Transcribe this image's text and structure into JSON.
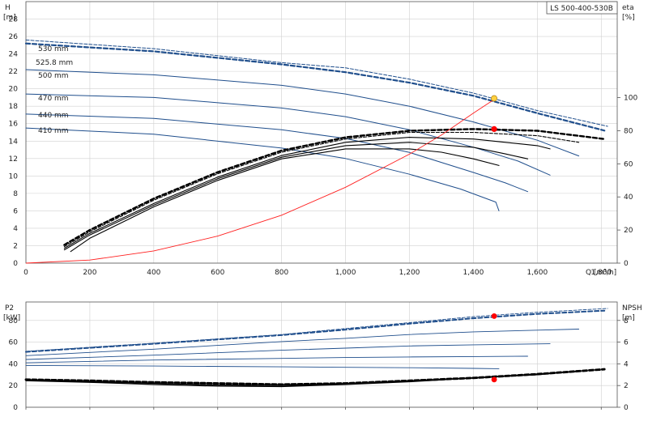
{
  "model": "LS 500-400-530B",
  "colors": {
    "curve": "#1f4e8c",
    "efficiency": "#000000",
    "system": "#ff2020",
    "duty_point": "#ff0000",
    "duty_point_top": "#ffd040",
    "grid": "#d0d0d0"
  },
  "chart_data": [
    {
      "id": "head",
      "type": "line",
      "x_label": "Q [m³/h]",
      "y_label_left": [
        "H",
        "[m]"
      ],
      "y_label_right": [
        "eta",
        "[%]"
      ],
      "xlim": [
        0,
        1850
      ],
      "ylim": [
        0,
        30
      ],
      "y2lim": [
        0,
        158
      ],
      "x_ticks": [
        0,
        200,
        400,
        600,
        800,
        1000,
        1200,
        1400,
        1600,
        1800
      ],
      "x_tick_labels": [
        "0",
        "200",
        "400",
        "600",
        "800",
        "1,000",
        "1,200",
        "1,400",
        "1,600",
        "1,800"
      ],
      "y_ticks": [
        0,
        2,
        4,
        6,
        8,
        10,
        12,
        14,
        16,
        18,
        20,
        22,
        24,
        26,
        28
      ],
      "y2_ticks": [
        0,
        20,
        40,
        60,
        80,
        100
      ],
      "grid": true,
      "series": [
        {
          "name": "530 mm",
          "style": "dashed-thin",
          "points": [
            [
              0,
              25.6
            ],
            [
              400,
              24.6
            ],
            [
              800,
              23.0
            ],
            [
              1000,
              22.4
            ],
            [
              1200,
              21.1
            ],
            [
              1400,
              19.5
            ],
            [
              1600,
              17.5
            ],
            [
              1820,
              15.7
            ]
          ]
        },
        {
          "name": "525.8 mm",
          "style": "dashed-bold",
          "points": [
            [
              0,
              25.2
            ],
            [
              400,
              24.3
            ],
            [
              800,
              22.8
            ],
            [
              1000,
              21.9
            ],
            [
              1200,
              20.7
            ],
            [
              1400,
              19.2
            ],
            [
              1600,
              17.2
            ],
            [
              1810,
              15.2
            ]
          ]
        },
        {
          "name": "500 mm",
          "style": "solid",
          "points": [
            [
              0,
              22.2
            ],
            [
              400,
              21.6
            ],
            [
              800,
              20.4
            ],
            [
              1000,
              19.4
            ],
            [
              1200,
              18.0
            ],
            [
              1400,
              16.2
            ],
            [
              1600,
              14.1
            ],
            [
              1730,
              12.3
            ]
          ]
        },
        {
          "name": "470 mm",
          "style": "solid",
          "points": [
            [
              0,
              19.4
            ],
            [
              400,
              19.0
            ],
            [
              800,
              17.8
            ],
            [
              1000,
              16.8
            ],
            [
              1200,
              15.3
            ],
            [
              1400,
              13.3
            ],
            [
              1540,
              11.7
            ],
            [
              1640,
              10.1
            ]
          ]
        },
        {
          "name": "440 mm",
          "style": "solid",
          "points": [
            [
              0,
              17.1
            ],
            [
              400,
              16.6
            ],
            [
              800,
              15.3
            ],
            [
              1000,
              14.3
            ],
            [
              1200,
              12.7
            ],
            [
              1400,
              10.4
            ],
            [
              1500,
              9.2
            ],
            [
              1570,
              8.2
            ]
          ]
        },
        {
          "name": "410 mm",
          "style": "solid",
          "points": [
            [
              0,
              15.5
            ],
            [
              400,
              14.8
            ],
            [
              800,
              13.2
            ],
            [
              1000,
              12.0
            ],
            [
              1200,
              10.2
            ],
            [
              1360,
              8.5
            ],
            [
              1470,
              7.0
            ],
            [
              1480,
              6.0
            ]
          ]
        }
      ],
      "efficiency_curves": [
        {
          "style": "dashed-bold",
          "points": [
            [
              120,
              11
            ],
            [
              200,
              20
            ],
            [
              400,
              39
            ],
            [
              600,
              55
            ],
            [
              800,
              68
            ],
            [
              1000,
              76
            ],
            [
              1200,
              80
            ],
            [
              1400,
              81
            ],
            [
              1600,
              80
            ],
            [
              1810,
              75
            ]
          ]
        },
        {
          "style": "dashed-thin",
          "points": [
            [
              120,
              10
            ],
            [
              200,
              19
            ],
            [
              400,
              38
            ],
            [
              600,
              54
            ],
            [
              800,
              67
            ],
            [
              1000,
              75
            ],
            [
              1200,
              79
            ],
            [
              1400,
              79
            ],
            [
              1600,
              77
            ],
            [
              1730,
              73
            ]
          ]
        },
        {
          "style": "solid",
          "points": [
            [
              120,
              9
            ],
            [
              200,
              18
            ],
            [
              400,
              36
            ],
            [
              600,
              52
            ],
            [
              800,
              65
            ],
            [
              1000,
              73
            ],
            [
              1200,
              76
            ],
            [
              1400,
              75
            ],
            [
              1600,
              71
            ],
            [
              1640,
              69
            ]
          ]
        },
        {
          "style": "solid",
          "points": [
            [
              120,
              8
            ],
            [
              200,
              17
            ],
            [
              400,
              35
            ],
            [
              600,
              51
            ],
            [
              800,
              64
            ],
            [
              1000,
              71
            ],
            [
              1200,
              73
            ],
            [
              1400,
              70
            ],
            [
              1500,
              66
            ],
            [
              1570,
              63
            ]
          ]
        },
        {
          "style": "solid",
          "points": [
            [
              140,
              7
            ],
            [
              200,
              15
            ],
            [
              400,
              34
            ],
            [
              600,
              50
            ],
            [
              800,
              63
            ],
            [
              1000,
              69
            ],
            [
              1200,
              69
            ],
            [
              1300,
              67
            ],
            [
              1400,
              63
            ],
            [
              1480,
              59
            ]
          ]
        }
      ],
      "system_curve": [
        [
          0,
          0
        ],
        [
          200,
          0.35
        ],
        [
          400,
          1.4
        ],
        [
          600,
          3.1
        ],
        [
          800,
          5.5
        ],
        [
          1000,
          8.7
        ],
        [
          1200,
          12.5
        ],
        [
          1300,
          14.7
        ],
        [
          1400,
          17.2
        ],
        [
          1470,
          18.9
        ]
      ],
      "duty_points": [
        {
          "x": 1465,
          "y": 18.9,
          "color": "#ffd040"
        },
        {
          "x": 1465,
          "y2": 81,
          "color": "#ff0000"
        }
      ]
    },
    {
      "id": "power",
      "type": "line",
      "y_label_left": [
        "P2",
        "[kW]"
      ],
      "y_label_right": [
        "NPSH",
        "[m]"
      ],
      "xlim": [
        0,
        1850
      ],
      "ylim": [
        0,
        97
      ],
      "y2lim": [
        0,
        9.7
      ],
      "y_ticks": [
        0,
        20,
        40,
        60,
        80
      ],
      "y2_ticks": [
        0,
        2,
        4,
        6,
        8
      ],
      "grid": true,
      "series": [
        {
          "name": "530 mm",
          "style": "dashed-thin",
          "points": [
            [
              0,
              51.5
            ],
            [
              400,
              59.0
            ],
            [
              800,
              67.0
            ],
            [
              1000,
              72.5
            ],
            [
              1200,
              78.0
            ],
            [
              1400,
              83.5
            ],
            [
              1600,
              87.5
            ],
            [
              1820,
              91.0
            ]
          ]
        },
        {
          "name": "525.8 mm",
          "style": "dashed-bold",
          "points": [
            [
              0,
              51.0
            ],
            [
              400,
              58.5
            ],
            [
              800,
              66.5
            ],
            [
              1000,
              71.5
            ],
            [
              1200,
              77.0
            ],
            [
              1400,
              82.0
            ],
            [
              1600,
              86.0
            ],
            [
              1810,
              89.0
            ]
          ]
        },
        {
          "name": "500 mm",
          "style": "solid",
          "points": [
            [
              0,
              47.5
            ],
            [
              400,
              53.5
            ],
            [
              800,
              60.5
            ],
            [
              1000,
              63.5
            ],
            [
              1200,
              67.0
            ],
            [
              1400,
              69.5
            ],
            [
              1600,
              71.0
            ],
            [
              1730,
              72.0
            ]
          ]
        },
        {
          "name": "470 mm",
          "style": "solid",
          "points": [
            [
              0,
              44.0
            ],
            [
              400,
              48.0
            ],
            [
              800,
              52.5
            ],
            [
              1000,
              54.5
            ],
            [
              1200,
              56.5
            ],
            [
              1400,
              57.5
            ],
            [
              1640,
              58.5
            ]
          ]
        },
        {
          "name": "440 mm",
          "style": "solid",
          "points": [
            [
              0,
              41.0
            ],
            [
              400,
              43.5
            ],
            [
              800,
              45.0
            ],
            [
              1000,
              45.8
            ],
            [
              1200,
              46.3
            ],
            [
              1400,
              46.7
            ],
            [
              1570,
              47.0
            ]
          ]
        },
        {
          "name": "410 mm",
          "style": "solid",
          "points": [
            [
              0,
              38.5
            ],
            [
              400,
              38.0
            ],
            [
              800,
              37.2
            ],
            [
              1000,
              36.8
            ],
            [
              1200,
              36.4
            ],
            [
              1400,
              35.8
            ],
            [
              1480,
              35.5
            ]
          ]
        }
      ],
      "npsh_curves": [
        {
          "style": "dashed-bold",
          "points": [
            [
              0,
              2.55
            ],
            [
              200,
              2.45
            ],
            [
              400,
              2.3
            ],
            [
              600,
              2.2
            ],
            [
              800,
              2.1
            ],
            [
              1000,
              2.2
            ],
            [
              1200,
              2.45
            ],
            [
              1400,
              2.7
            ],
            [
              1600,
              3.05
            ],
            [
              1810,
              3.5
            ]
          ]
        },
        {
          "style": "solid",
          "points": [
            [
              0,
              2.5
            ],
            [
              200,
              2.35
            ],
            [
              400,
              2.2
            ],
            [
              600,
              2.05
            ],
            [
              800,
              2.0
            ],
            [
              1000,
              2.15
            ],
            [
              1200,
              2.4
            ],
            [
              1400,
              2.7
            ],
            [
              1600,
              3.05
            ],
            [
              1730,
              3.3
            ]
          ]
        },
        {
          "style": "solid",
          "points": [
            [
              0,
              2.45
            ],
            [
              200,
              2.3
            ],
            [
              400,
              2.1
            ],
            [
              600,
              1.95
            ],
            [
              800,
              1.9
            ],
            [
              1000,
              2.1
            ],
            [
              1200,
              2.35
            ],
            [
              1400,
              2.7
            ],
            [
              1600,
              3.0
            ],
            [
              1640,
              3.1
            ]
          ]
        }
      ],
      "duty_points": [
        {
          "x": 1465,
          "y": 84,
          "color": "#ff0000"
        },
        {
          "x": 1465,
          "y2": 2.55,
          "color": "#ff0000"
        }
      ]
    }
  ]
}
